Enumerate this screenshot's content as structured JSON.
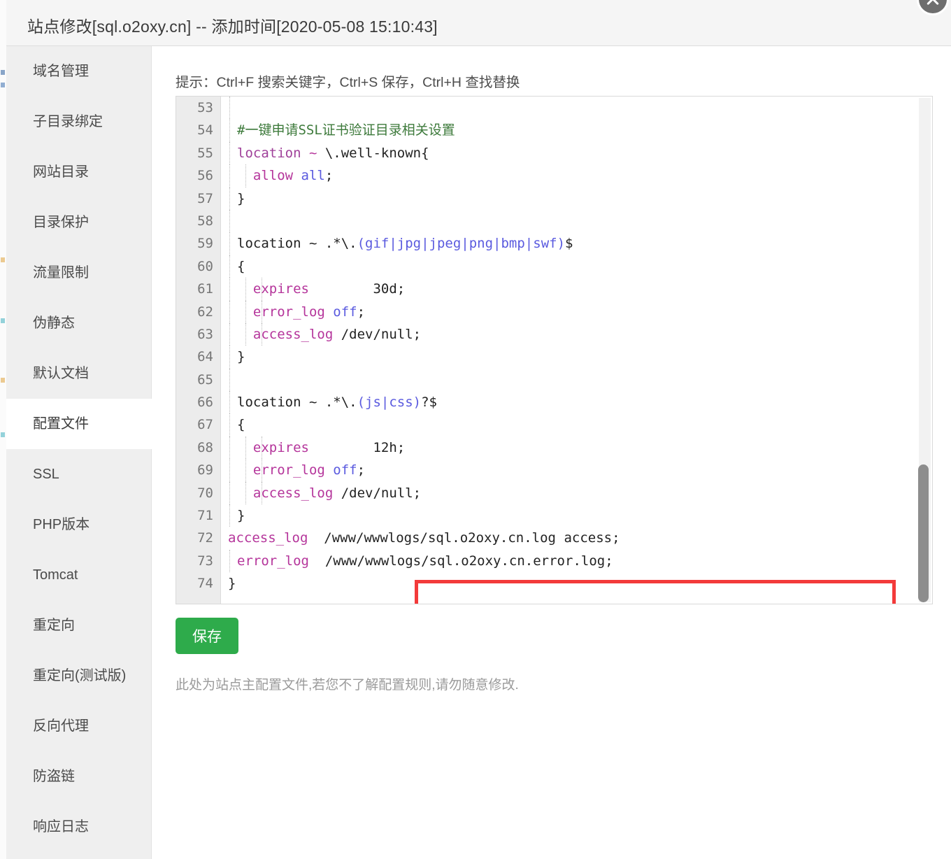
{
  "window": {
    "title": "站点修改[sql.o2oxy.cn] -- 添加时间[2020-05-08 15:10:43]",
    "close_icon": "close-icon"
  },
  "sidebar": {
    "items": [
      {
        "label": "域名管理",
        "active": false
      },
      {
        "label": "子目录绑定",
        "active": false
      },
      {
        "label": "网站目录",
        "active": false
      },
      {
        "label": "目录保护",
        "active": false
      },
      {
        "label": "流量限制",
        "active": false
      },
      {
        "label": "伪静态",
        "active": false
      },
      {
        "label": "默认文档",
        "active": false
      },
      {
        "label": "配置文件",
        "active": true
      },
      {
        "label": "SSL",
        "active": false
      },
      {
        "label": "PHP版本",
        "active": false
      },
      {
        "label": "Tomcat",
        "active": false
      },
      {
        "label": "重定向",
        "active": false
      },
      {
        "label": "重定向(测试版)",
        "active": false
      },
      {
        "label": "反向代理",
        "active": false
      },
      {
        "label": "防盗链",
        "active": false
      },
      {
        "label": "响应日志",
        "active": false
      }
    ]
  },
  "content": {
    "hint": "提示：Ctrl+F 搜索关键字，Ctrl+S 保存，Ctrl+H 查找替换",
    "save_label": "保存",
    "footnote": "此处为站点主配置文件,若您不了解配置规则,请勿随意修改.",
    "accent_green": "#2eab4b",
    "annotation_color": "#f33a3a"
  },
  "editor": {
    "first_line": 53,
    "last_line": 74,
    "scroll_position": "bottom",
    "lines": [
      {
        "n": 53,
        "indent": 1,
        "text": "",
        "tokens": []
      },
      {
        "n": 54,
        "indent": 1,
        "text": "#一键申请SSL证书验证目录相关设置",
        "tokens": [
          {
            "t": "#一键申请SSL证书验证目录相关设置",
            "c": "t-cmt"
          }
        ]
      },
      {
        "n": 55,
        "indent": 1,
        "text": "location ~ \\.well-known{",
        "tokens": [
          {
            "t": "location",
            "c": "t-key"
          },
          {
            "t": " ~ ",
            "c": "t-dir"
          },
          {
            "t": "\\.well-known{",
            "c": "t-plain"
          }
        ]
      },
      {
        "n": 56,
        "indent": 2,
        "text": "  allow all;",
        "tokens": [
          {
            "t": "  ",
            "c": "t-plain"
          },
          {
            "t": "allow",
            "c": "t-dir"
          },
          {
            "t": " ",
            "c": "t-plain"
          },
          {
            "t": "all",
            "c": "t-val"
          },
          {
            "t": ";",
            "c": "t-plain"
          }
        ]
      },
      {
        "n": 57,
        "indent": 1,
        "text": "}",
        "tokens": [
          {
            "t": "}",
            "c": "t-plain"
          }
        ]
      },
      {
        "n": 58,
        "indent": 1,
        "text": "",
        "tokens": []
      },
      {
        "n": 59,
        "indent": 1,
        "text": "location ~ .*\\.(gif|jpg|jpeg|png|bmp|swf)$",
        "tokens": [
          {
            "t": "location ~ .*\\.",
            "c": "t-plain"
          },
          {
            "t": "(gif|jpg|jpeg|png|bmp|swf)",
            "c": "t-val"
          },
          {
            "t": "$",
            "c": "t-plain"
          }
        ]
      },
      {
        "n": 60,
        "indent": 1,
        "text": "{",
        "tokens": [
          {
            "t": "{",
            "c": "t-plain"
          }
        ]
      },
      {
        "n": 61,
        "indent": 3,
        "text": "  expires        30d;",
        "tokens": [
          {
            "t": "  ",
            "c": "t-plain"
          },
          {
            "t": "expires",
            "c": "t-dir"
          },
          {
            "t": "        30d;",
            "c": "t-plain"
          }
        ]
      },
      {
        "n": 62,
        "indent": 3,
        "text": "  error_log off;",
        "tokens": [
          {
            "t": "  ",
            "c": "t-plain"
          },
          {
            "t": "error_log",
            "c": "t-dir"
          },
          {
            "t": " ",
            "c": "t-plain"
          },
          {
            "t": "off",
            "c": "t-val"
          },
          {
            "t": ";",
            "c": "t-plain"
          }
        ]
      },
      {
        "n": 63,
        "indent": 3,
        "text": "  access_log /dev/null;",
        "tokens": [
          {
            "t": "  ",
            "c": "t-plain"
          },
          {
            "t": "access_log",
            "c": "t-dir"
          },
          {
            "t": " /dev/null;",
            "c": "t-plain"
          }
        ]
      },
      {
        "n": 64,
        "indent": 1,
        "text": "}",
        "tokens": [
          {
            "t": "}",
            "c": "t-plain"
          }
        ]
      },
      {
        "n": 65,
        "indent": 1,
        "text": "",
        "tokens": []
      },
      {
        "n": 66,
        "indent": 1,
        "text": "location ~ .*\\.(js|css)?$",
        "tokens": [
          {
            "t": "location ~ .*\\.",
            "c": "t-plain"
          },
          {
            "t": "(js|css)",
            "c": "t-val"
          },
          {
            "t": "?$",
            "c": "t-plain"
          }
        ]
      },
      {
        "n": 67,
        "indent": 1,
        "text": "{",
        "tokens": [
          {
            "t": "{",
            "c": "t-plain"
          }
        ]
      },
      {
        "n": 68,
        "indent": 3,
        "text": "  expires        12h;",
        "tokens": [
          {
            "t": "  ",
            "c": "t-plain"
          },
          {
            "t": "expires",
            "c": "t-dir"
          },
          {
            "t": "        12h;",
            "c": "t-plain"
          }
        ]
      },
      {
        "n": 69,
        "indent": 3,
        "text": "  error_log off;",
        "tokens": [
          {
            "t": "  ",
            "c": "t-plain"
          },
          {
            "t": "error_log",
            "c": "t-dir"
          },
          {
            "t": " ",
            "c": "t-plain"
          },
          {
            "t": "off",
            "c": "t-val"
          },
          {
            "t": ";",
            "c": "t-plain"
          }
        ]
      },
      {
        "n": 70,
        "indent": 3,
        "text": "  access_log /dev/null;",
        "tokens": [
          {
            "t": "  ",
            "c": "t-plain"
          },
          {
            "t": "access_log",
            "c": "t-dir"
          },
          {
            "t": " /dev/null;",
            "c": "t-plain"
          }
        ]
      },
      {
        "n": 71,
        "indent": 1,
        "text": "}",
        "tokens": [
          {
            "t": "}",
            "c": "t-plain"
          }
        ]
      },
      {
        "n": 72,
        "indent": 0,
        "text": "access_log  /www/wwwlogs/sql.o2oxy.cn.log access;",
        "tokens": [
          {
            "t": "access_log",
            "c": "t-dir"
          },
          {
            "t": "  /www/wwwlogs/sql.o2oxy.cn.log access;",
            "c": "t-plain"
          }
        ]
      },
      {
        "n": 73,
        "indent": 1,
        "text": "error_log  /www/wwwlogs/sql.o2oxy.cn.error.log;",
        "tokens": [
          {
            "t": "error_log",
            "c": "t-dir"
          },
          {
            "t": "  /www/wwwlogs/sql.o2oxy.cn.error.log;",
            "c": "t-plain"
          }
        ]
      },
      {
        "n": 74,
        "indent": 0,
        "text": "}",
        "tokens": [
          {
            "t": "}",
            "c": "t-plain"
          }
        ]
      }
    ]
  }
}
